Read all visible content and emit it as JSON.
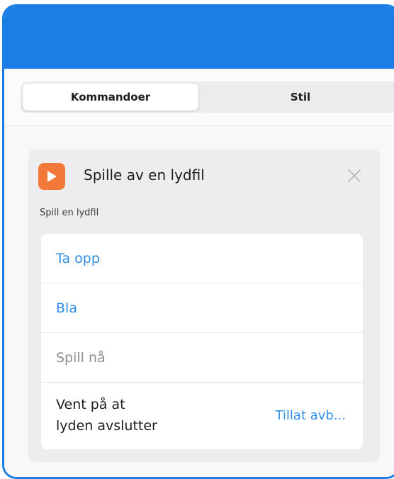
{
  "tabs": [
    {
      "label": "Kommandoer",
      "active": true
    },
    {
      "label": "Stil",
      "active": false
    }
  ],
  "action": {
    "title": "Spille av en lydfil",
    "subtitle": "Spill en lydfil",
    "icon": "play-icon",
    "icon_color": "#f2793a",
    "options": {
      "record": "Ta opp",
      "browse": "Bla",
      "play_now": "Spill nå",
      "wait_label": "Vent på at\nlyden avslutter",
      "wait_value": "Tillat avb..."
    }
  },
  "colors": {
    "accent": "#1a7ee6",
    "link": "#2f8fe6"
  }
}
